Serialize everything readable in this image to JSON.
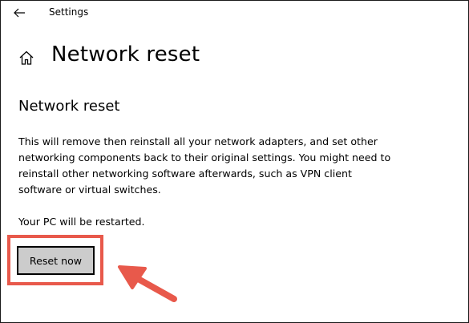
{
  "window": {
    "title": "Settings"
  },
  "header": {
    "page_title": "Network reset"
  },
  "section": {
    "title": "Network reset",
    "description": "This will remove then reinstall all your network adapters, and set other networking components back to their original settings. You might need to reinstall other networking software afterwards, such as VPN client software or virtual switches.",
    "restart_note": "Your PC will be restarted."
  },
  "actions": {
    "reset_label": "Reset now"
  },
  "icons": {
    "back": "back-arrow-icon",
    "home": "home-icon",
    "annotation": "pointer-arrow-icon"
  },
  "colors": {
    "annotation": "#e8594b",
    "button_bg": "#cccccc"
  }
}
